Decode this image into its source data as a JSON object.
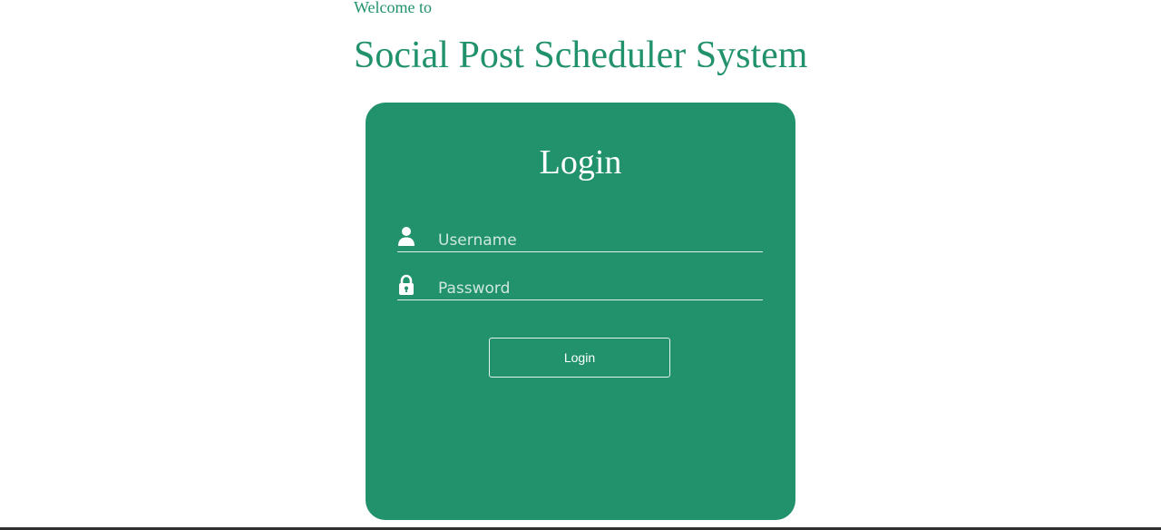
{
  "header": {
    "welcome_text": "Welcome to",
    "app_title": "Social Post Scheduler System"
  },
  "login": {
    "heading": "Login",
    "username": {
      "placeholder": "Username",
      "value": "",
      "icon": "user-icon"
    },
    "password": {
      "placeholder": "Password",
      "value": "",
      "icon": "lock-icon"
    },
    "submit_label": "Login"
  },
  "colors": {
    "brand_green": "#21926c",
    "text_white": "#ffffff",
    "page_background": "#ffffff"
  }
}
